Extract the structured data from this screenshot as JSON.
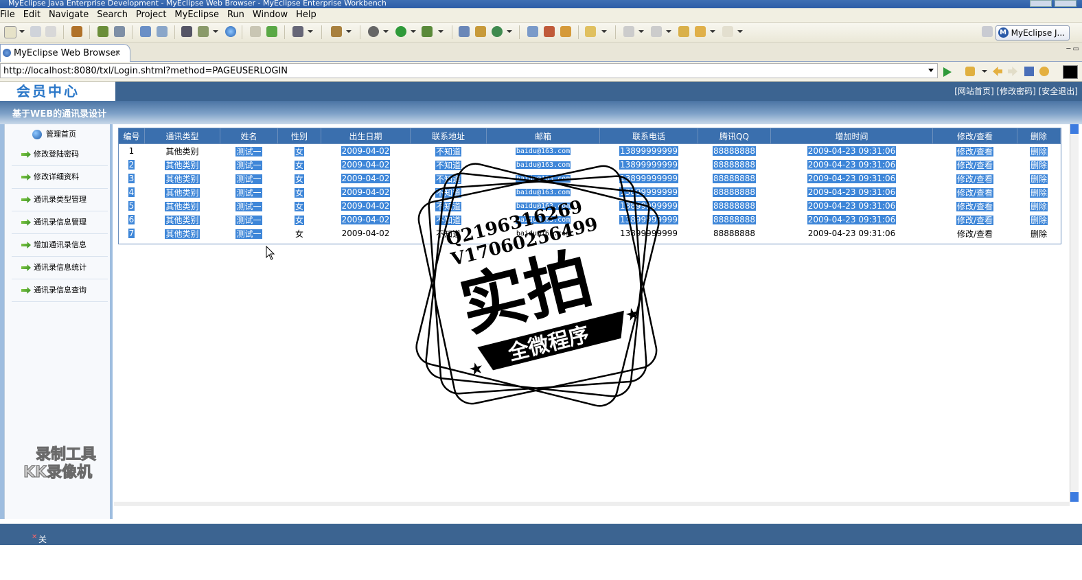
{
  "window": {
    "title": "MyEclipse Java Enterprise Development - MyEclipse Web Browser - MyEclipse Enterprise Workbench"
  },
  "menu": [
    "File",
    "Edit",
    "Navigate",
    "Search",
    "Project",
    "MyEclipse",
    "Run",
    "Window",
    "Help"
  ],
  "perspective": {
    "label": "MyEclipse J..."
  },
  "editor_tab": {
    "label": "MyEclipse Web Browser",
    "close": "✕"
  },
  "browser": {
    "url": "http://localhost:8080/txl/Login.shtml?method=PAGEUSERLOGIN"
  },
  "site": {
    "logo": "会员中心",
    "top_links": "[网站首页] [修改密码] [安全退出]",
    "title": "基于WEB的通讯录设计"
  },
  "sidebar": {
    "home": "管理首页",
    "items": [
      "修改登陆密码",
      "修改详细资料",
      "通讯录类型管理",
      "通讯录信息管理",
      "增加通讯录信息",
      "通讯录信息统计",
      "通讯录信息查询"
    ],
    "close_label": "关闭左栏"
  },
  "table": {
    "headers": [
      "编号",
      "通讯类型",
      "姓名",
      "性别",
      "出生日期",
      "联系地址",
      "邮箱",
      "联系电话",
      "腾讯QQ",
      "增加时间",
      "修改/查看",
      "删除"
    ],
    "rows": [
      [
        "1",
        "其他类别",
        "测试一",
        "女",
        "2009-04-02",
        "不知道",
        "baidu@163.com",
        "13899999999",
        "88888888",
        "2009-04-23 09:31:06",
        "修改/查看",
        "删除"
      ],
      [
        "2",
        "其他类别",
        "测试一",
        "女",
        "2009-04-02",
        "不知道",
        "baidu@163.com",
        "13899999999",
        "88888888",
        "2009-04-23 09:31:06",
        "修改/查看",
        "删除"
      ],
      [
        "3",
        "其他类别",
        "测试一",
        "女",
        "2009-04-02",
        "不知道",
        "baidu@163.com",
        "13899999999",
        "88888888",
        "2009-04-23 09:31:06",
        "修改/查看",
        "删除"
      ],
      [
        "4",
        "其他类别",
        "测试一",
        "女",
        "2009-04-02",
        "不知道",
        "baidu@163.com",
        "13899999999",
        "88888888",
        "2009-04-23 09:31:06",
        "修改/查看",
        "删除"
      ],
      [
        "5",
        "其他类别",
        "测试一",
        "女",
        "2009-04-02",
        "不知道",
        "baidu@163.com",
        "13899999999",
        "88888888",
        "2009-04-23 09:31:06",
        "修改/查看",
        "删除"
      ],
      [
        "6",
        "其他类别",
        "测试一",
        "女",
        "2009-04-02",
        "不知道",
        "baidu@163.com",
        "13899999999",
        "88888888",
        "2009-04-23 09:31:06",
        "修改/查看",
        "删除"
      ],
      [
        "7",
        "其他类别",
        "测试一",
        "女",
        "2009-04-02",
        "不知道",
        "baidu@163.com",
        "13899999999",
        "88888888",
        "2009-04-23 09:31:06",
        "修改/查看",
        "删除"
      ]
    ]
  },
  "stamp": {
    "line1": "Q2196316269",
    "line2": "V17060256499",
    "main": "实拍",
    "banner": "全微程序"
  },
  "watermark": [
    "录制工具",
    "KK录像机"
  ]
}
